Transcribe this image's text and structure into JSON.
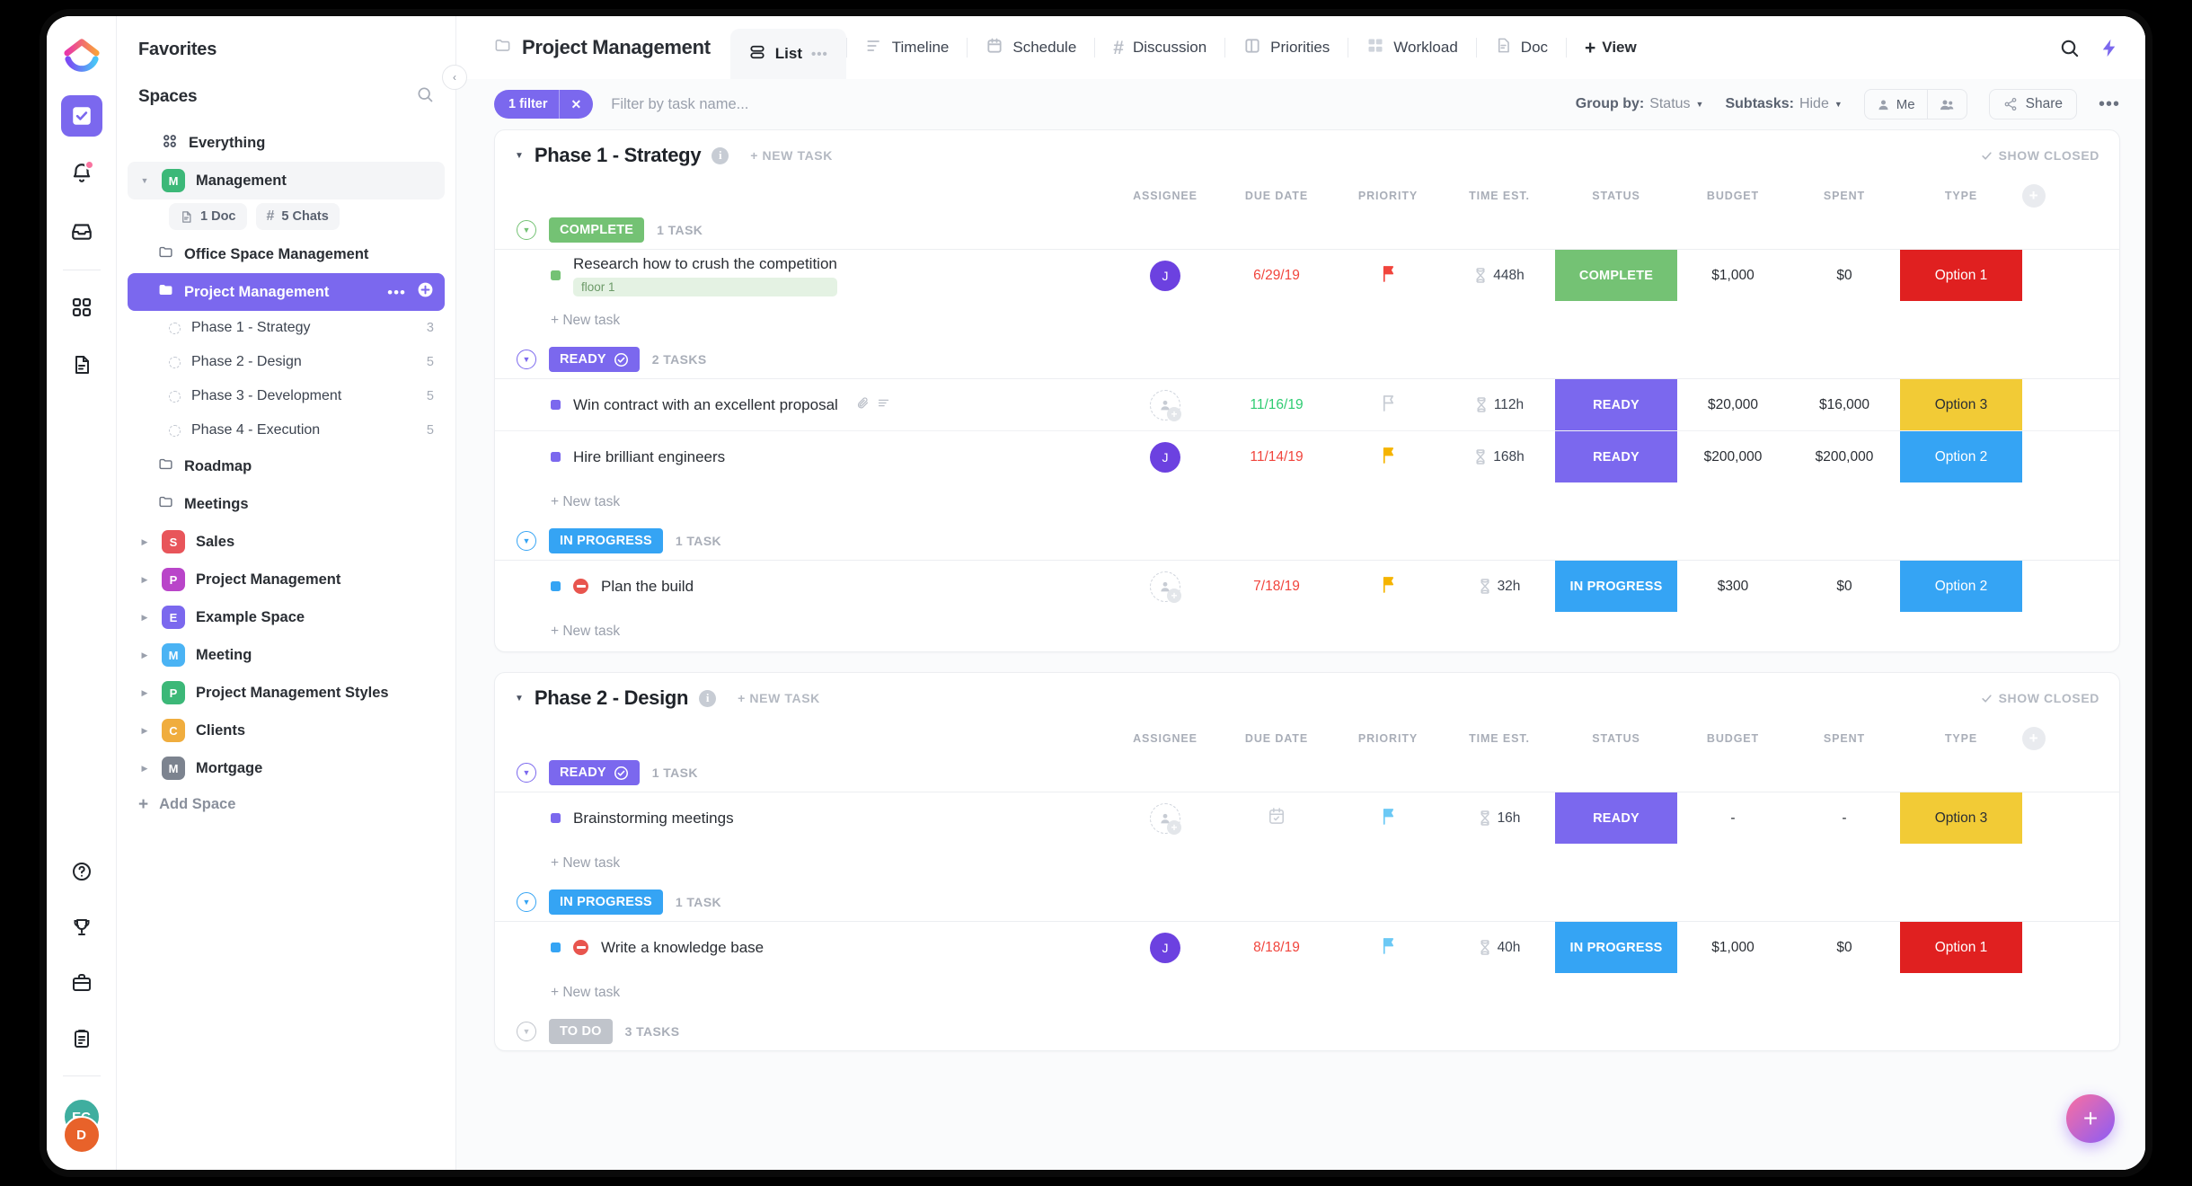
{
  "rail": {
    "logo_name": "clickup-logo",
    "items": [
      {
        "name": "tasks-icon",
        "active": true
      },
      {
        "name": "notifications-bell-icon",
        "active": false,
        "badge": true
      },
      {
        "name": "inbox-tray-icon",
        "active": false
      },
      {
        "name": "dashboards-grid-icon",
        "active": false
      },
      {
        "name": "docs-icon",
        "active": false
      }
    ],
    "bottom_items": [
      {
        "name": "help-question-icon"
      },
      {
        "name": "trophy-goals-icon"
      },
      {
        "name": "briefcase-portfolio-icon"
      },
      {
        "name": "clipboard-icon"
      }
    ],
    "avatars": [
      {
        "initials": "EC",
        "color": "#3fae9f"
      },
      {
        "initials": "D",
        "color": "#e8622a"
      }
    ]
  },
  "sidebar": {
    "favorites_label": "Favorites",
    "spaces_label": "Spaces",
    "everything_label": "Everything",
    "management": {
      "label": "Management",
      "badge_letter": "M",
      "badge_color": "#3cb878",
      "chips": [
        {
          "label": "1 Doc",
          "icon": "doc-icon"
        },
        {
          "label": "5 Chats",
          "icon": "hash-icon"
        }
      ],
      "folders": [
        {
          "label": "Office Space Management",
          "selected": false
        },
        {
          "label": "Project Management",
          "selected": true
        }
      ],
      "lists": [
        {
          "label": "Phase 1 - Strategy",
          "count": "3"
        },
        {
          "label": "Phase 2 - Design",
          "count": "5"
        },
        {
          "label": "Phase 3 - Development",
          "count": "5"
        },
        {
          "label": "Phase 4 - Execution",
          "count": "5"
        }
      ],
      "more_folders": [
        {
          "label": "Roadmap"
        },
        {
          "label": "Meetings"
        }
      ]
    },
    "spaces": [
      {
        "label": "Sales",
        "badge_letter": "S",
        "badge_color": "#e8555a"
      },
      {
        "label": "Project Management",
        "badge_letter": "P",
        "badge_color": "#b945c9"
      },
      {
        "label": "Example Space",
        "badge_letter": "E",
        "badge_color": "#7b68ee"
      },
      {
        "label": "Meeting",
        "badge_letter": "M",
        "badge_color": "#4ab3f4"
      },
      {
        "label": "Project Management Styles",
        "badge_letter": "P",
        "badge_color": "#3cb878"
      },
      {
        "label": "Clients",
        "badge_letter": "C",
        "badge_color": "#f0ad3e"
      },
      {
        "label": "Mortgage",
        "badge_letter": "M",
        "badge_color": "#7c838f"
      }
    ],
    "add_space_label": "Add Space"
  },
  "header": {
    "breadcrumb": "Project Management",
    "tabs": [
      {
        "label": "List",
        "icon": "list-view-icon",
        "active": true,
        "has_dots": true
      },
      {
        "label": "Timeline",
        "icon": "timeline-icon",
        "active": false
      },
      {
        "label": "Schedule",
        "icon": "calendar-icon",
        "active": false
      },
      {
        "label": "Discussion",
        "icon": "hash-icon",
        "active": false
      },
      {
        "label": "Priorities",
        "icon": "board-icon",
        "active": false
      },
      {
        "label": "Workload",
        "icon": "workload-grid-icon",
        "active": false
      },
      {
        "label": "Doc",
        "icon": "doc-icon",
        "active": false
      }
    ],
    "add_view_label": "View",
    "search_icon": "search-icon",
    "automation_icon": "lightning-bolt-icon"
  },
  "filterbar": {
    "filter_count_label": "1 filter",
    "clear_label": "✕",
    "search_placeholder": "Filter by task name...",
    "group_by_label": "Group by:",
    "group_by_value": "Status",
    "subtasks_label": "Subtasks:",
    "subtasks_value": "Hide",
    "me_label": "Me",
    "share_label": "Share",
    "more_label": "•••"
  },
  "columns": [
    "ASSIGNEE",
    "DUE DATE",
    "PRIORITY",
    "TIME EST.",
    "STATUS",
    "BUDGET",
    "SPENT",
    "TYPE"
  ],
  "labels": {
    "new_task_top": "+ NEW TASK",
    "show_closed": "SHOW CLOSED",
    "new_task_inline": "+ New task"
  },
  "colors": {
    "complete": "#74c274",
    "ready": "#7b68ee",
    "in_progress": "#35a4f4",
    "todo": "#c0c4cb",
    "option1": "#e02020",
    "option2": "#35a4f4",
    "option3": "#f2cb36",
    "accent": "#7b68ee"
  },
  "phases": [
    {
      "title": "Phase 1 - Strategy",
      "groups": [
        {
          "status": "COMPLETE",
          "status_color": "#74c274",
          "status_check": false,
          "count_label": "1 TASK",
          "tasks": [
            {
              "name": "Research how to crush the competition",
              "tag": "floor 1",
              "square_color": "#74c274",
              "blocked": false,
              "assignee": "J",
              "assignee_color": "#6c41e0",
              "due": "6/29/19",
              "due_color": "red",
              "priority": "flag-red",
              "time": "448h",
              "status": "COMPLETE",
              "status_color": "#74c274",
              "budget": "$1,000",
              "spent": "$0",
              "type": "Option 1",
              "type_color": "#e02020",
              "type_text_color": "#ffffff",
              "has_attachment": false
            }
          ]
        },
        {
          "status": "READY",
          "status_color": "#7b68ee",
          "status_check": true,
          "count_label": "2 TASKS",
          "tasks": [
            {
              "name": "Win contract with an excellent proposal",
              "tag": null,
              "square_color": "#7b68ee",
              "blocked": false,
              "assignee": null,
              "assignee_color": null,
              "due": "11/16/19",
              "due_color": "green",
              "priority": "flag-gray",
              "time": "112h",
              "status": "READY",
              "status_color": "#7b68ee",
              "budget": "$20,000",
              "spent": "$16,000",
              "type": "Option 3",
              "type_color": "#f2cb36",
              "type_text_color": "#2a2e34",
              "has_attachment": true
            },
            {
              "name": "Hire brilliant engineers",
              "tag": null,
              "square_color": "#7b68ee",
              "blocked": false,
              "assignee": "J",
              "assignee_color": "#6c41e0",
              "due": "11/14/19",
              "due_color": "red",
              "priority": "flag-yellow",
              "time": "168h",
              "status": "READY",
              "status_color": "#7b68ee",
              "budget": "$200,000",
              "spent": "$200,000",
              "type": "Option 2",
              "type_color": "#35a4f4",
              "type_text_color": "#ffffff",
              "has_attachment": false
            }
          ]
        },
        {
          "status": "IN PROGRESS",
          "status_color": "#35a4f4",
          "status_check": false,
          "count_label": "1 TASK",
          "tasks": [
            {
              "name": "Plan the build",
              "tag": null,
              "square_color": "#35a4f4",
              "blocked": true,
              "assignee": null,
              "assignee_color": null,
              "due": "7/18/19",
              "due_color": "red",
              "priority": "flag-yellow",
              "time": "32h",
              "status": "IN PROGRESS",
              "status_color": "#35a4f4",
              "budget": "$300",
              "spent": "$0",
              "type": "Option 2",
              "type_color": "#35a4f4",
              "type_text_color": "#ffffff",
              "has_attachment": false
            }
          ]
        }
      ]
    },
    {
      "title": "Phase 2 - Design",
      "groups": [
        {
          "status": "READY",
          "status_color": "#7b68ee",
          "status_check": true,
          "count_label": "1 TASK",
          "tasks": [
            {
              "name": "Brainstorming meetings",
              "tag": null,
              "square_color": "#7b68ee",
              "blocked": false,
              "assignee": null,
              "assignee_color": null,
              "due": "",
              "due_color": "calendar-icon",
              "priority": "flag-blue",
              "time": "16h",
              "status": "READY",
              "status_color": "#7b68ee",
              "budget": "-",
              "spent": "-",
              "type": "Option 3",
              "type_color": "#f2cb36",
              "type_text_color": "#2a2e34",
              "has_attachment": false
            }
          ]
        },
        {
          "status": "IN PROGRESS",
          "status_color": "#35a4f4",
          "status_check": false,
          "count_label": "1 TASK",
          "tasks": [
            {
              "name": "Write a knowledge base",
              "tag": null,
              "square_color": "#35a4f4",
              "blocked": true,
              "assignee": "J",
              "assignee_color": "#6c41e0",
              "due": "8/18/19",
              "due_color": "red",
              "priority": "flag-blue",
              "time": "40h",
              "status": "IN PROGRESS",
              "status_color": "#35a4f4",
              "budget": "$1,000",
              "spent": "$0",
              "type": "Option 1",
              "type_color": "#e02020",
              "type_text_color": "#ffffff",
              "has_attachment": false
            }
          ]
        },
        {
          "status": "TO DO",
          "status_color": "#c0c4cb",
          "status_check": false,
          "count_label": "3 TASKS",
          "tasks": []
        }
      ]
    }
  ],
  "fab_label": "+"
}
